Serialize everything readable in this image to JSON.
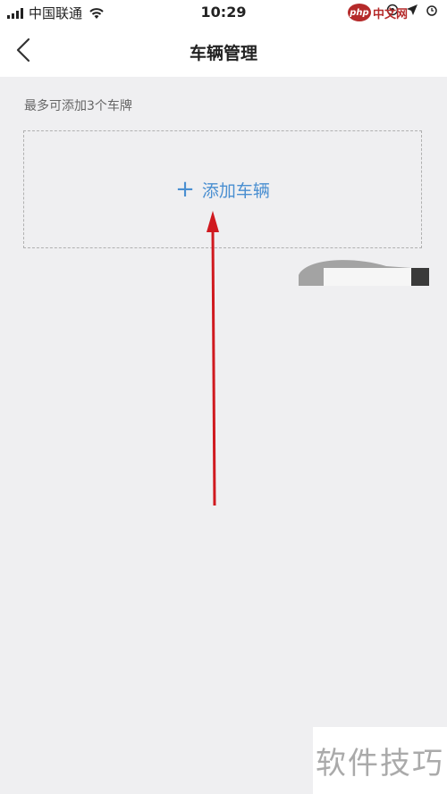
{
  "status_bar": {
    "carrier": "中国联通",
    "time": "10:29"
  },
  "nav": {
    "title": "车辆管理",
    "back_icon": "chevron-left-icon"
  },
  "main": {
    "hint": "最多可添加3个车牌",
    "add_vehicle_label": "添加车辆",
    "add_icon": "plus-icon"
  },
  "watermark": {
    "top_badge": "php",
    "top_label": "中文网",
    "bottom_label": "软件技巧"
  },
  "colors": {
    "accent": "#4a8fd1",
    "arrow": "#d0191f",
    "background": "#efeff1"
  }
}
